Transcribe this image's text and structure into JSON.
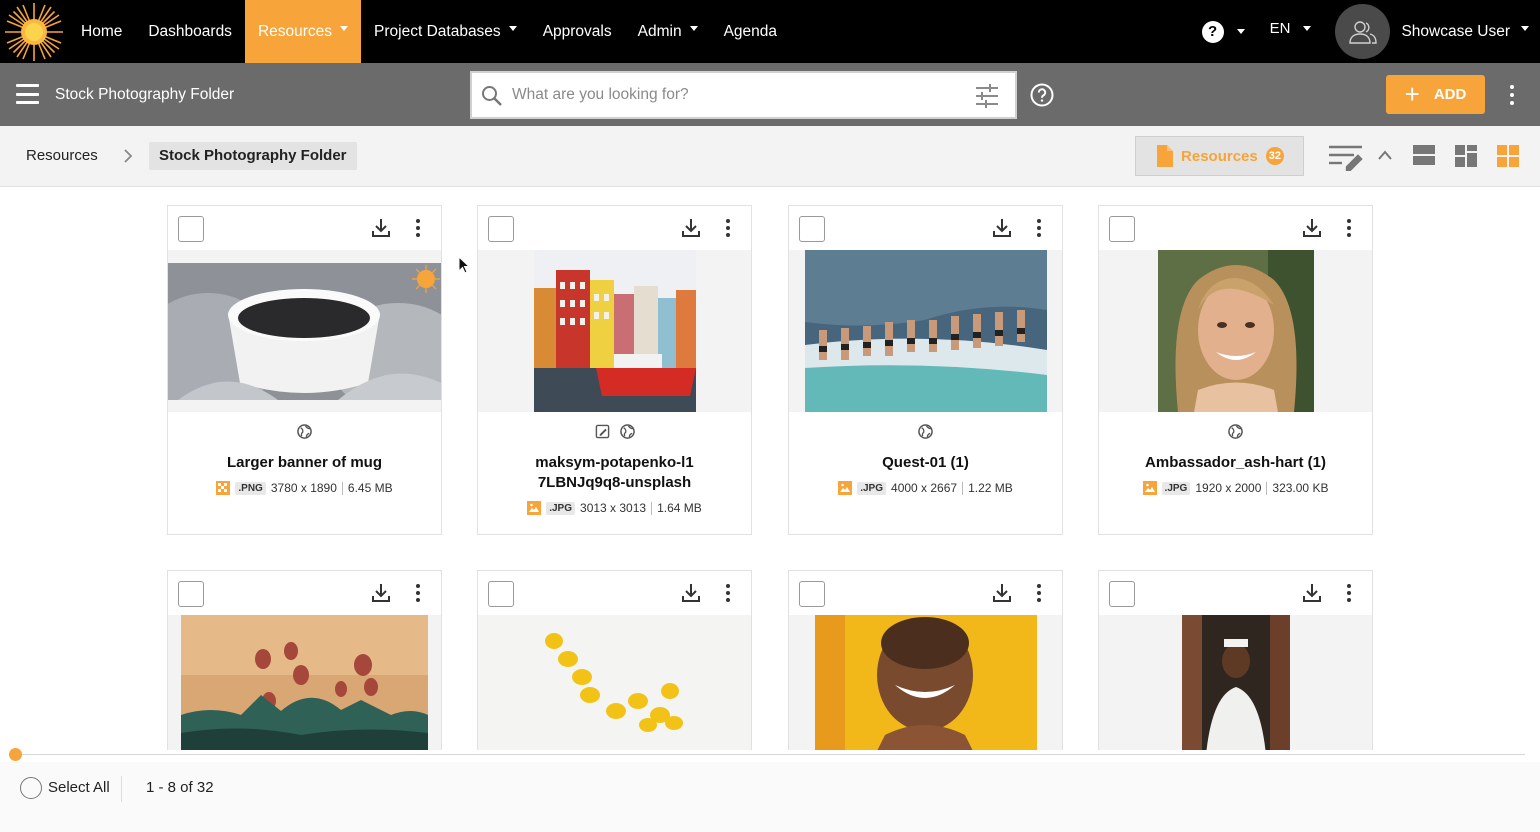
{
  "nav": {
    "items": [
      {
        "label": "Home",
        "caret": false,
        "active": false
      },
      {
        "label": "Dashboards",
        "caret": false,
        "active": false
      },
      {
        "label": "Resources",
        "caret": true,
        "active": true
      },
      {
        "label": "Project Databases",
        "caret": true,
        "active": false
      },
      {
        "label": "Approvals",
        "caret": false,
        "active": false
      },
      {
        "label": "Admin",
        "caret": true,
        "active": false
      },
      {
        "label": "Agenda",
        "caret": false,
        "active": false
      }
    ],
    "help_symbol": "?",
    "language": "EN",
    "user_name": "Showcase User"
  },
  "subbar": {
    "folder_title": "Stock Photography Folder",
    "search_placeholder": "What are you looking for?",
    "add_label": "ADD"
  },
  "breadcrumb": {
    "root": "Resources",
    "current": "Stock Photography Folder"
  },
  "resources_button": {
    "label": "Resources",
    "count": "32"
  },
  "cards": [
    {
      "title": "Larger banner of mug",
      "ext": ".PNG",
      "dims": "3780 x 1890",
      "size": "6.45 MB",
      "edited": false
    },
    {
      "title": "maksym-potapenko-l17LBNJq9q8-unsplash",
      "ext": ".JPG",
      "dims": "3013 x 3013",
      "size": "1.64 MB",
      "edited": true
    },
    {
      "title": "Quest-01 (1)",
      "ext": ".JPG",
      "dims": "4000 x 2667",
      "size": "1.22 MB",
      "edited": false
    },
    {
      "title": "Ambassador_ash-hart (1)",
      "ext": ".JPG",
      "dims": "1920 x 2000",
      "size": "323.00 KB",
      "edited": false
    }
  ],
  "footer": {
    "select_all": "Select All",
    "pagination": "1 - 8 of 32"
  },
  "colors": {
    "accent": "#f7a43a",
    "topbar": "#000000",
    "subbar": "#6b6b6b",
    "crumbbar": "#f3f3f3"
  }
}
